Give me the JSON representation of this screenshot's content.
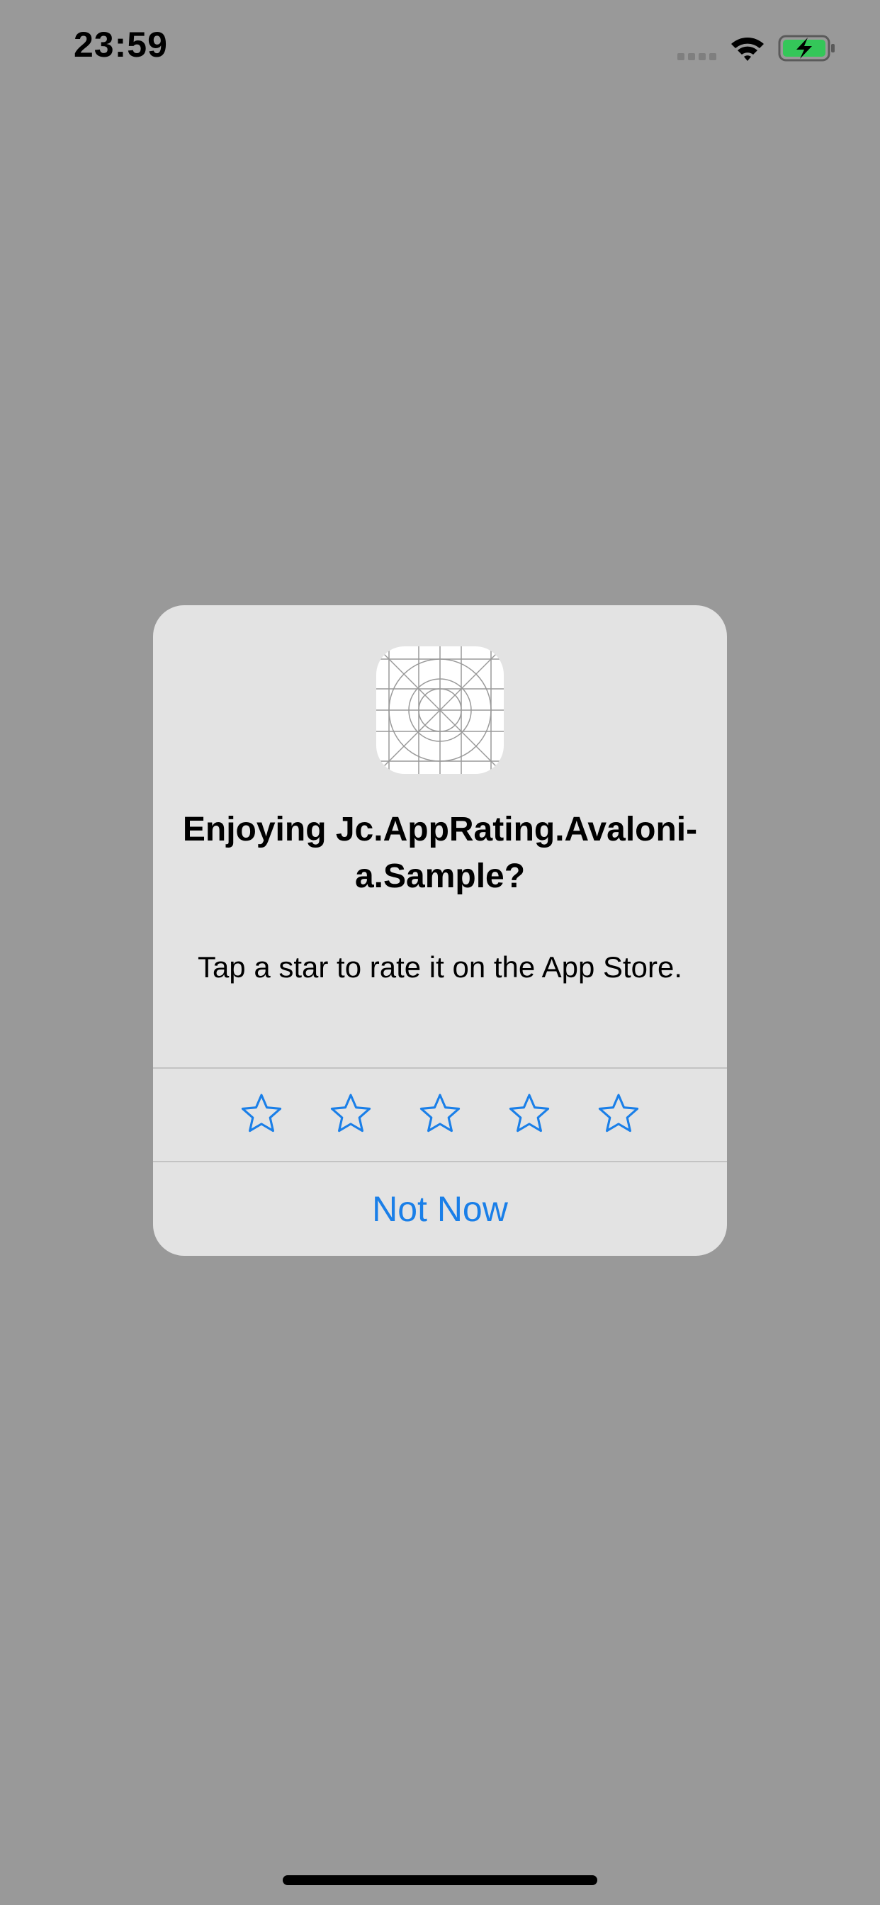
{
  "status_bar": {
    "time": "23:59",
    "signal_icon": "cellular-dots-icon",
    "wifi_icon": "wifi-icon",
    "battery_icon": "battery-charging-icon"
  },
  "dialog": {
    "app_icon": "app-icon-placeholder-grid",
    "title": "Enjoying Jc.AppRating.Avaloni-a.Sample?",
    "message": "Tap a star to rate it on the App Store.",
    "stars": [
      {
        "icon": "star-outline-icon"
      },
      {
        "icon": "star-outline-icon"
      },
      {
        "icon": "star-outline-icon"
      },
      {
        "icon": "star-outline-icon"
      },
      {
        "icon": "star-outline-icon"
      }
    ],
    "not_now_label": "Not Now"
  },
  "colors": {
    "backdrop": "#999999",
    "dialog_bg": "#e3e3e3",
    "accent": "#1a7fe8",
    "battery_fill": "#34c759"
  }
}
